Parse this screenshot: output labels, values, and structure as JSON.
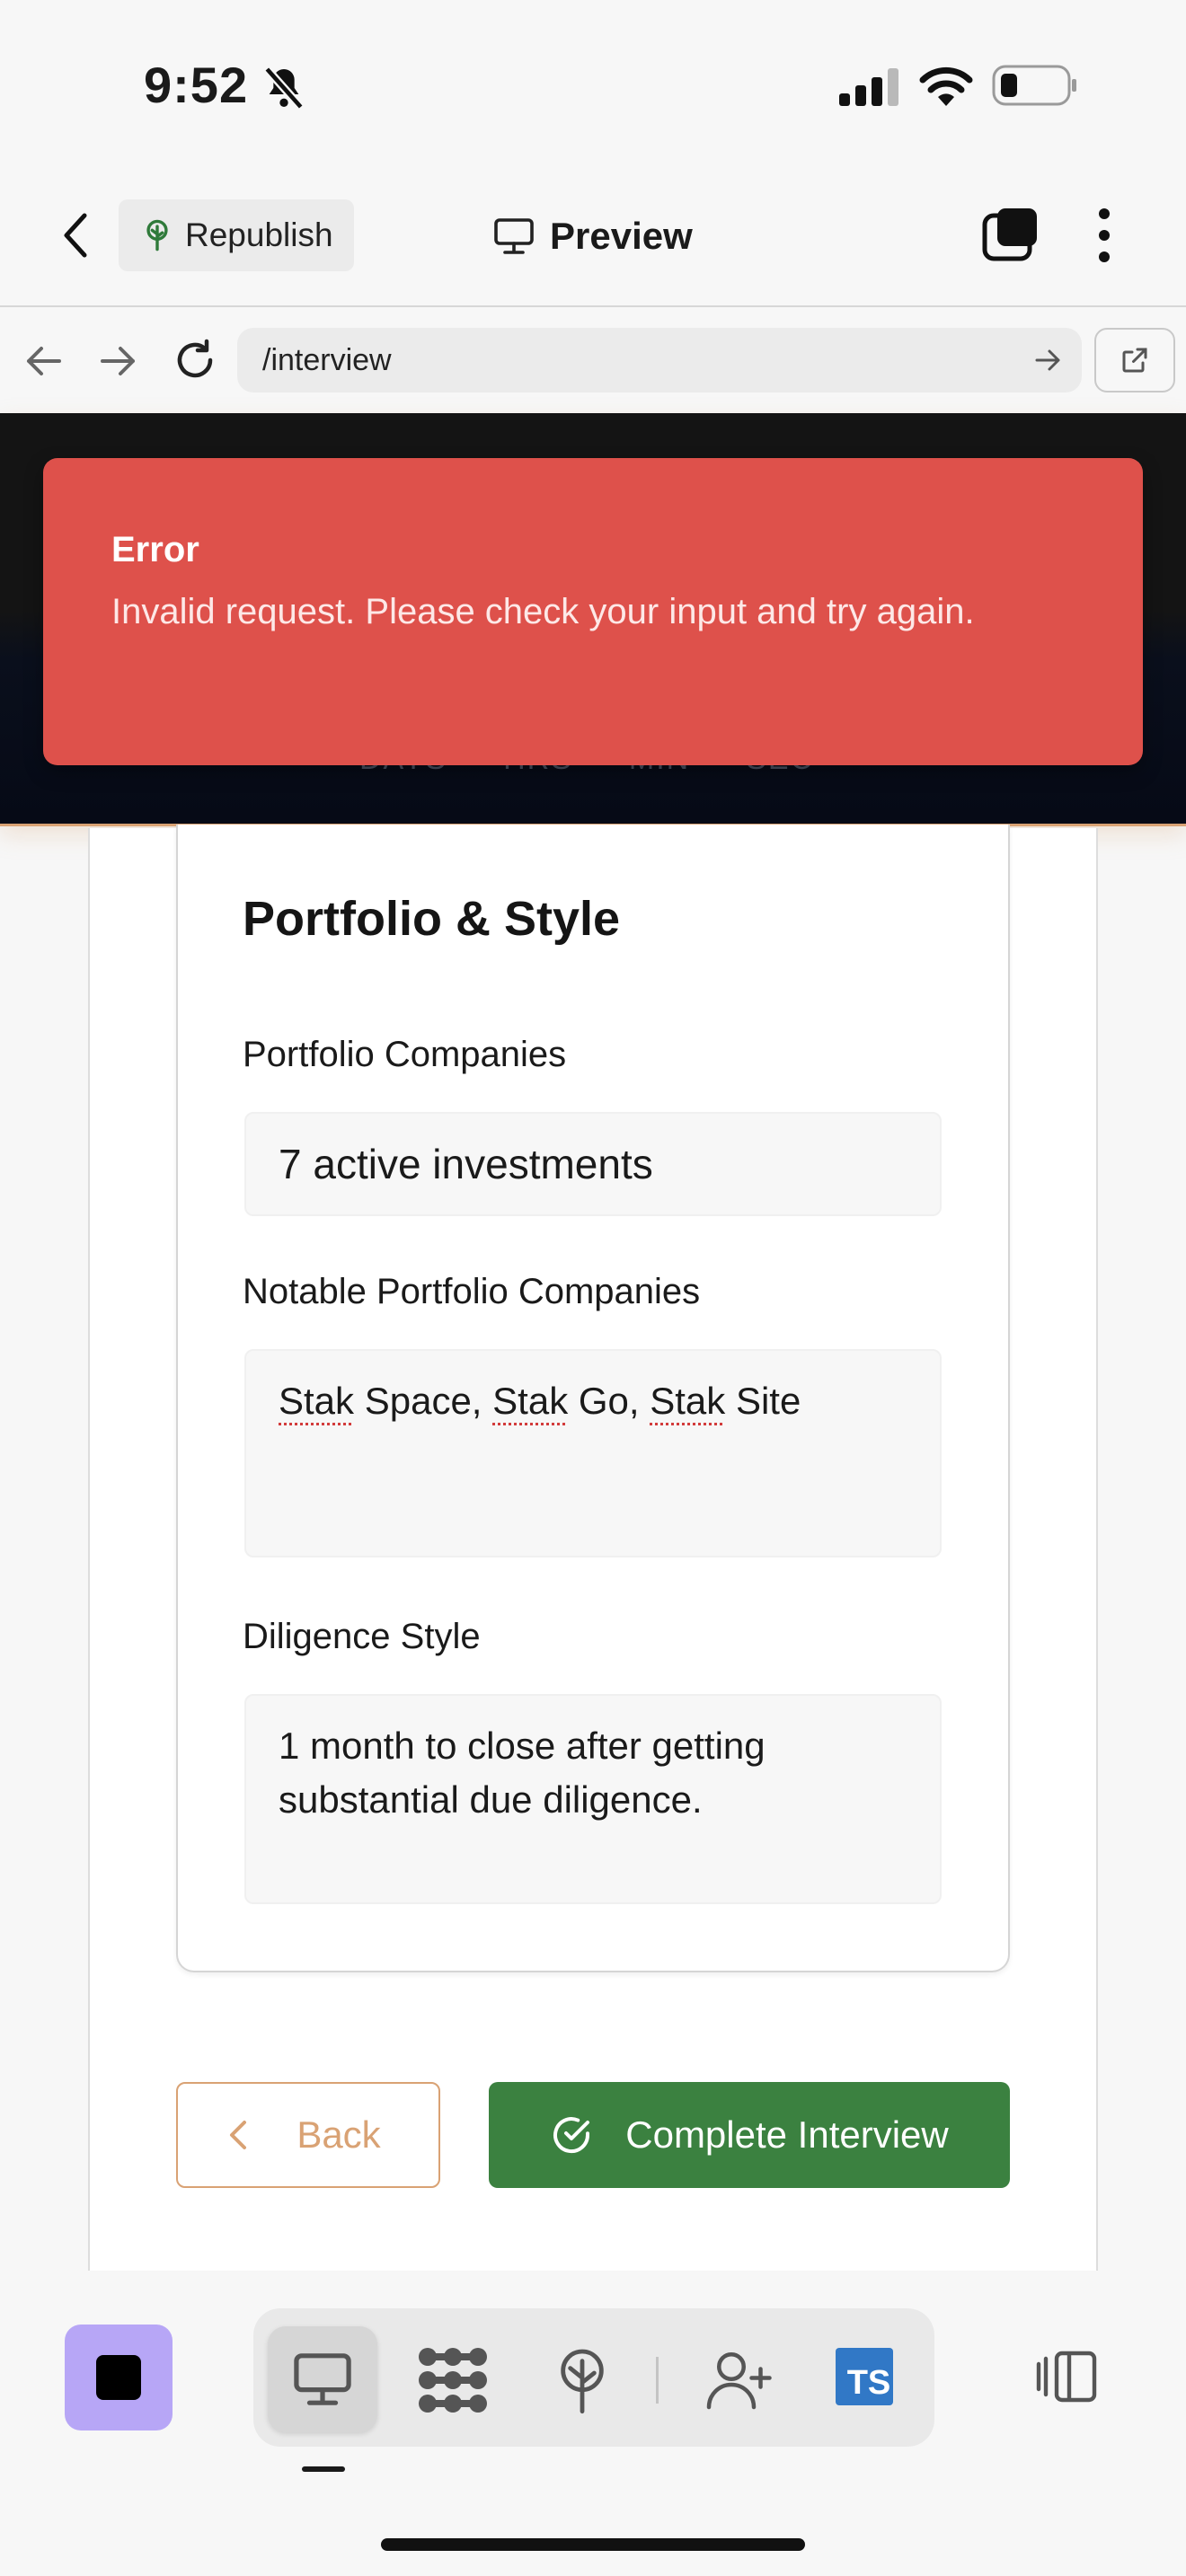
{
  "status_bar": {
    "time": "9:52"
  },
  "app_bar": {
    "republish_label": "Republish",
    "title": "Preview"
  },
  "browser": {
    "url": "/interview"
  },
  "countdown": {
    "labels": [
      "DAYS",
      "HRS",
      "MIN",
      "SEC"
    ]
  },
  "toast": {
    "title": "Error",
    "message": "Invalid request. Please check your input and try again."
  },
  "form": {
    "section_title": "Portfolio & Style",
    "portfolio_companies": {
      "label": "Portfolio Companies",
      "value": "7 active investments"
    },
    "notable_companies": {
      "label": "Notable Portfolio Companies",
      "value_parts": [
        "Stak",
        " Space, ",
        "Stak",
        " Go, ",
        "Stak",
        " Site"
      ]
    },
    "diligence_style": {
      "label": "Diligence Style",
      "value": "1 month to close after getting substantial due diligence."
    }
  },
  "actions": {
    "back_label": "Back",
    "complete_label": "Complete Interview"
  },
  "toolbar": {
    "ts_label": "TS"
  },
  "colors": {
    "toast_bg": "#de514b",
    "accent_orange": "#d9a274",
    "complete_green": "#3b8140",
    "stop_purple": "#b7a6f6",
    "ts_blue": "#3178c6"
  }
}
